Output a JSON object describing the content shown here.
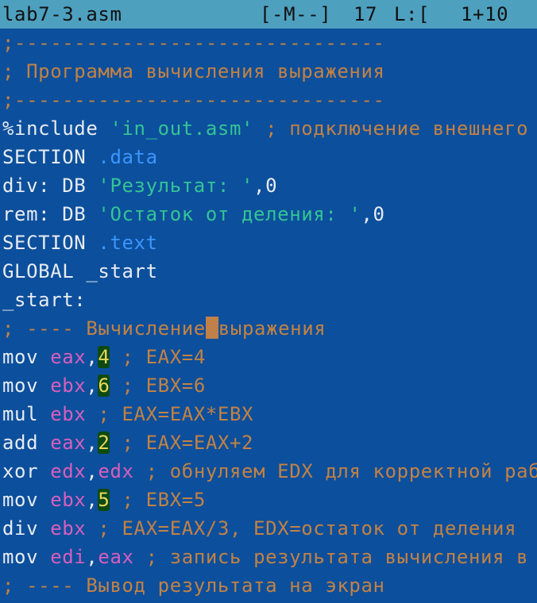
{
  "status": {
    "filename": "lab7-3.asm",
    "mode": "[-M--]",
    "column": "17",
    "line_label": "L:[",
    "position": "1+10"
  },
  "code": {
    "l1": ";-------------------------------",
    "l2": "; Программа вычисления выражения",
    "l3": ";-------------------------------",
    "l4_kw": "%include ",
    "l4_str": "'in_out.asm'",
    "l4_cmt": " ; подключение внешнего файла",
    "l5_kw": "SECTION ",
    "l5_sec": ".data",
    "l6_lbl": "div: DB ",
    "l6_str": "'Результат: '",
    "l6_rest": ",0",
    "l7_lbl": "rem: DB ",
    "l7_str": "'Остаток от деления: '",
    "l7_rest": ",0",
    "l8_kw": "SECTION ",
    "l8_sec": ".text",
    "l9": "GLOBAL _start",
    "l10": "_start:",
    "l11_a": "; ---- Вычисление",
    "l11_b": "выражения",
    "l12_op": "mov ",
    "l12_reg": "eax",
    "l12_comma": ",",
    "l12_num": "4",
    "l12_cmt": " ; EAX=4",
    "l13_op": "mov ",
    "l13_reg": "ebx",
    "l13_comma": ",",
    "l13_num": "6",
    "l13_cmt": " ; EBX=6",
    "l14_op": "mul ",
    "l14_reg": "ebx",
    "l14_cmt": " ; EAX=EAX*EBX",
    "l15_op": "add ",
    "l15_reg": "eax",
    "l15_comma": ",",
    "l15_num": "2",
    "l15_cmt": " ; EAX=EAX+2",
    "l16_op": "xor ",
    "l16_reg1": "edx",
    "l16_comma": ",",
    "l16_reg2": "edx",
    "l16_cmt": " ; обнуляем EDX для корректной работы div",
    "l17_op": "mov ",
    "l17_reg": "ebx",
    "l17_comma": ",",
    "l17_num": "5",
    "l17_cmt": " ; EBX=5",
    "l18_op": "div ",
    "l18_reg": "ebx",
    "l18_cmt": " ; EAX=EAX/3, EDX=остаток от деления",
    "l19_op": "mov ",
    "l19_reg1": "edi",
    "l19_comma": ",",
    "l19_reg2": "eax",
    "l19_cmt": " ; запись результата вычисления в edi",
    "l20": "; ---- Вывод результата на экран"
  }
}
